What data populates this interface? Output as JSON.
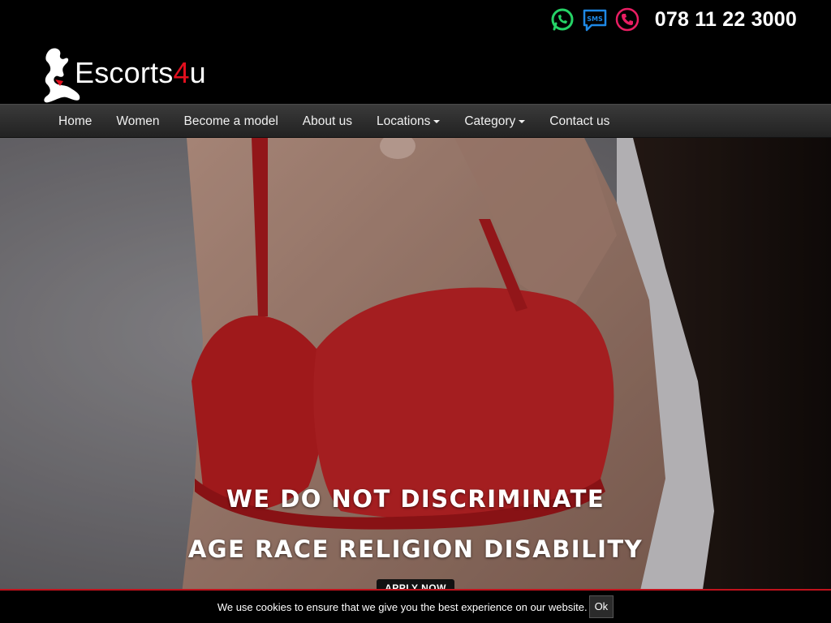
{
  "brand": {
    "name_prefix": "Escorts",
    "name_number": "4",
    "name_suffix": "u",
    "accent_color": "#e10f1e"
  },
  "contact": {
    "icons": [
      "whatsapp-icon",
      "sms-icon",
      "phone-call-icon"
    ],
    "phone": "078 11 22 3000",
    "colors": {
      "whatsapp": "#25d366",
      "sms": "#1e88e5",
      "call": "#e91e63"
    }
  },
  "nav": {
    "items": [
      {
        "label": "Home",
        "dropdown": false
      },
      {
        "label": "Women",
        "dropdown": false
      },
      {
        "label": "Become a model",
        "dropdown": false
      },
      {
        "label": "About us",
        "dropdown": false
      },
      {
        "label": "Locations",
        "dropdown": true
      },
      {
        "label": "Category",
        "dropdown": true
      },
      {
        "label": "Contact us",
        "dropdown": false
      }
    ]
  },
  "hero": {
    "line1": "WE DO NOT DISCRIMINATE",
    "line2": "AGE RACE RELIGION DISABILITY",
    "cta": "APPLY NOW"
  },
  "cookie": {
    "message": "We use cookies to ensure that we give you the best experience on our website.",
    "ok_label": "Ok"
  }
}
